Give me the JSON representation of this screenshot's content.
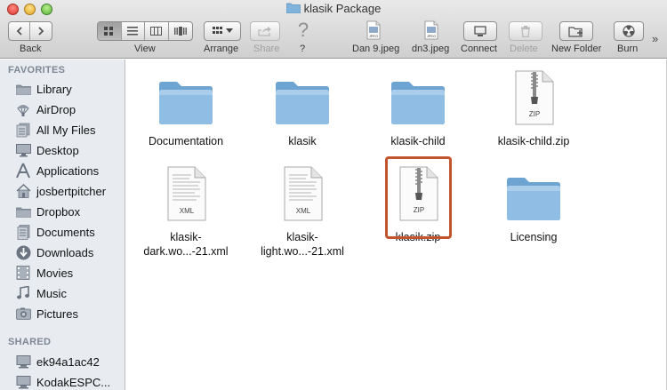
{
  "window": {
    "title": "klasik Package"
  },
  "toolbar": {
    "back_label": "Back",
    "view_label": "View",
    "arrange_label": "Arrange",
    "share_label": "Share",
    "help_label": "?",
    "help_glyph": "?",
    "files": [
      {
        "label": "Dan 9.jpeg",
        "badge": "JPEG"
      },
      {
        "label": "dn3.jpeg",
        "badge": "JPEG"
      }
    ],
    "connect_label": "Connect",
    "delete_label": "Delete",
    "new_folder_label": "New Folder",
    "burn_label": "Burn"
  },
  "sidebar": {
    "favorites_header": "FAVORITES",
    "favorites": [
      {
        "label": "Library",
        "icon": "folder-icon"
      },
      {
        "label": "AirDrop",
        "icon": "airdrop-icon"
      },
      {
        "label": "All My Files",
        "icon": "all-files-icon"
      },
      {
        "label": "Desktop",
        "icon": "desktop-icon"
      },
      {
        "label": "Applications",
        "icon": "applications-icon"
      },
      {
        "label": "josbertpitcher",
        "icon": "home-icon"
      },
      {
        "label": "Dropbox",
        "icon": "folder-icon"
      },
      {
        "label": "Documents",
        "icon": "documents-icon"
      },
      {
        "label": "Downloads",
        "icon": "downloads-icon"
      },
      {
        "label": "Movies",
        "icon": "movies-icon"
      },
      {
        "label": "Music",
        "icon": "music-icon"
      },
      {
        "label": "Pictures",
        "icon": "pictures-icon"
      }
    ],
    "shared_header": "SHARED",
    "shared": [
      {
        "label": "ek94a1ac42",
        "icon": "computer-icon"
      },
      {
        "label": "KodakESPC...",
        "icon": "computer-icon"
      }
    ]
  },
  "files": [
    {
      "name_lines": [
        "Documentation"
      ],
      "kind": "folder",
      "badge": ""
    },
    {
      "name_lines": [
        "klasik"
      ],
      "kind": "folder",
      "badge": ""
    },
    {
      "name_lines": [
        "klasik-child"
      ],
      "kind": "folder",
      "badge": ""
    },
    {
      "name_lines": [
        "klasik-child.zip"
      ],
      "kind": "zip",
      "badge": "ZIP"
    },
    {
      "name_lines": [
        "klasik-",
        "dark.wo...-21.xml"
      ],
      "kind": "xml",
      "badge": "XML"
    },
    {
      "name_lines": [
        "klasik-",
        "light.wo...-21.xml"
      ],
      "kind": "xml",
      "badge": "XML"
    },
    {
      "name_lines": [
        "klasik.zip"
      ],
      "kind": "zip",
      "badge": "ZIP",
      "selected": true
    },
    {
      "name_lines": [
        "Licensing"
      ],
      "kind": "folder",
      "badge": ""
    }
  ],
  "colors": {
    "selection_outline": "#c2552e",
    "folder_blue": "#7fb3dc"
  }
}
